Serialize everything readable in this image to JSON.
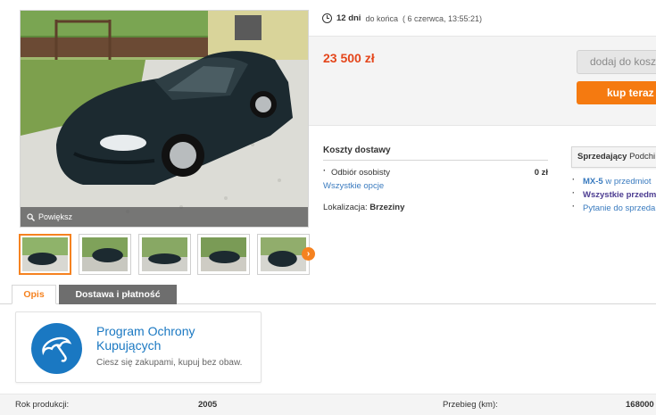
{
  "gallery": {
    "zoom_label": "Powiększ",
    "thumb_count": 5,
    "next_icon": "›"
  },
  "timer": {
    "days": "12 dni",
    "suffix": "do końca",
    "date": "( 6 czerwca, 13:55:21)"
  },
  "price": "23 500 zł",
  "buttons": {
    "add_to_basket": "dodaj do koszyka",
    "buy_now": "kup teraz"
  },
  "delivery": {
    "title": "Koszty dostawy",
    "option_name": "Odbiór osobisty",
    "option_cost": "0 zł",
    "all_options": "Wszystkie opcje",
    "location_label": "Lokalizacja:",
    "location_value": "Brzeziny"
  },
  "seller": {
    "label": "Sprzedający",
    "name": "Podchi",
    "links": {
      "model": "MX-5",
      "model_suffix": "w przedmiot",
      "all_items": "Wszystkie przedm",
      "ask": "Pytanie do sprzeda"
    }
  },
  "tabs": {
    "description": "Opis",
    "delivery_payment": "Dostawa i płatność"
  },
  "protection": {
    "title": "Program Ochrony Kupujących",
    "subtitle": "Ciesz się zakupami, kupuj bez obaw."
  },
  "specs": {
    "year_label": "Rok produkcji:",
    "year_value": "2005",
    "mileage_label": "Przebieg (km):",
    "mileage_value": "168000"
  },
  "colors": {
    "accent_orange": "#f57a10",
    "price_red": "#e4451a",
    "link_blue": "#3a7bbf",
    "protection_blue": "#1a78c2",
    "car_color": "#1c2a30"
  },
  "icons": {
    "timer": "clock-icon",
    "zoom": "magnifier-icon",
    "protection": "umbrella-icon"
  }
}
